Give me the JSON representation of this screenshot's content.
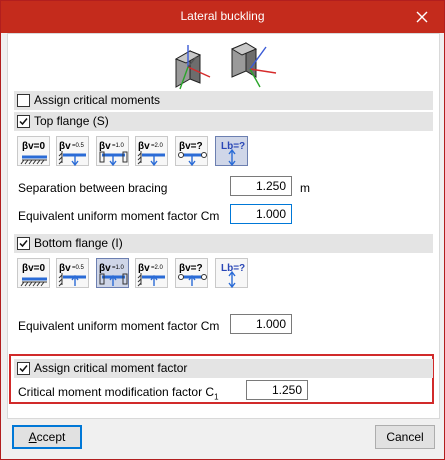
{
  "window": {
    "title": "Lateral buckling"
  },
  "sections": {
    "assign_critical_moments": {
      "label": "Assign critical moments",
      "checked": false
    },
    "top_flange": {
      "label": "Top flange (S)",
      "checked": true
    },
    "bottom_flange": {
      "label": "Bottom flange (I)",
      "checked": true
    },
    "assign_factor": {
      "label": "Assign critical moment factor",
      "checked": true
    }
  },
  "top_buttons": [
    {
      "label": "βv=0",
      "icon": "fixed-support-icon"
    },
    {
      "label": "βv=0.5",
      "icon": "half-fixed-icon"
    },
    {
      "label": "βv=1.0",
      "icon": "pinned-icon"
    },
    {
      "label": "βv=2.0",
      "icon": "cantilever-icon"
    },
    {
      "label": "βv=?",
      "icon": "custom-beta-icon"
    },
    {
      "label": "Lb=?",
      "icon": "custom-length-icon",
      "selected": true
    }
  ],
  "bottom_buttons": [
    {
      "label": "βv=0",
      "icon": "fixed-support-icon"
    },
    {
      "label": "βv=0.5",
      "icon": "half-fixed-icon"
    },
    {
      "label": "βv=1.0",
      "icon": "pinned-icon",
      "selected": true
    },
    {
      "label": "βv=2.0",
      "icon": "cantilever-icon"
    },
    {
      "label": "βv=?",
      "icon": "custom-beta-icon"
    },
    {
      "label": "Lb=?",
      "icon": "custom-length-icon"
    }
  ],
  "top_flange": {
    "separation_label": "Separation between bracing",
    "separation_value": "1.250",
    "separation_unit": "m",
    "cm_label": "Equivalent uniform moment factor Cm",
    "cm_value": "1.000"
  },
  "bottom_flange": {
    "cm_label": "Equivalent uniform moment factor Cm",
    "cm_value": "1.000"
  },
  "factor": {
    "label": "Critical moment modification factor C",
    "subscript": "1",
    "value": "1.250"
  },
  "footer": {
    "accept": "Accept",
    "accept_underline": "A",
    "accept_rest": "ccept",
    "cancel": "Cancel"
  },
  "colors": {
    "titlebar": "#c42b1c",
    "highlight": "#d12a2a",
    "focus": "#0078d7"
  }
}
